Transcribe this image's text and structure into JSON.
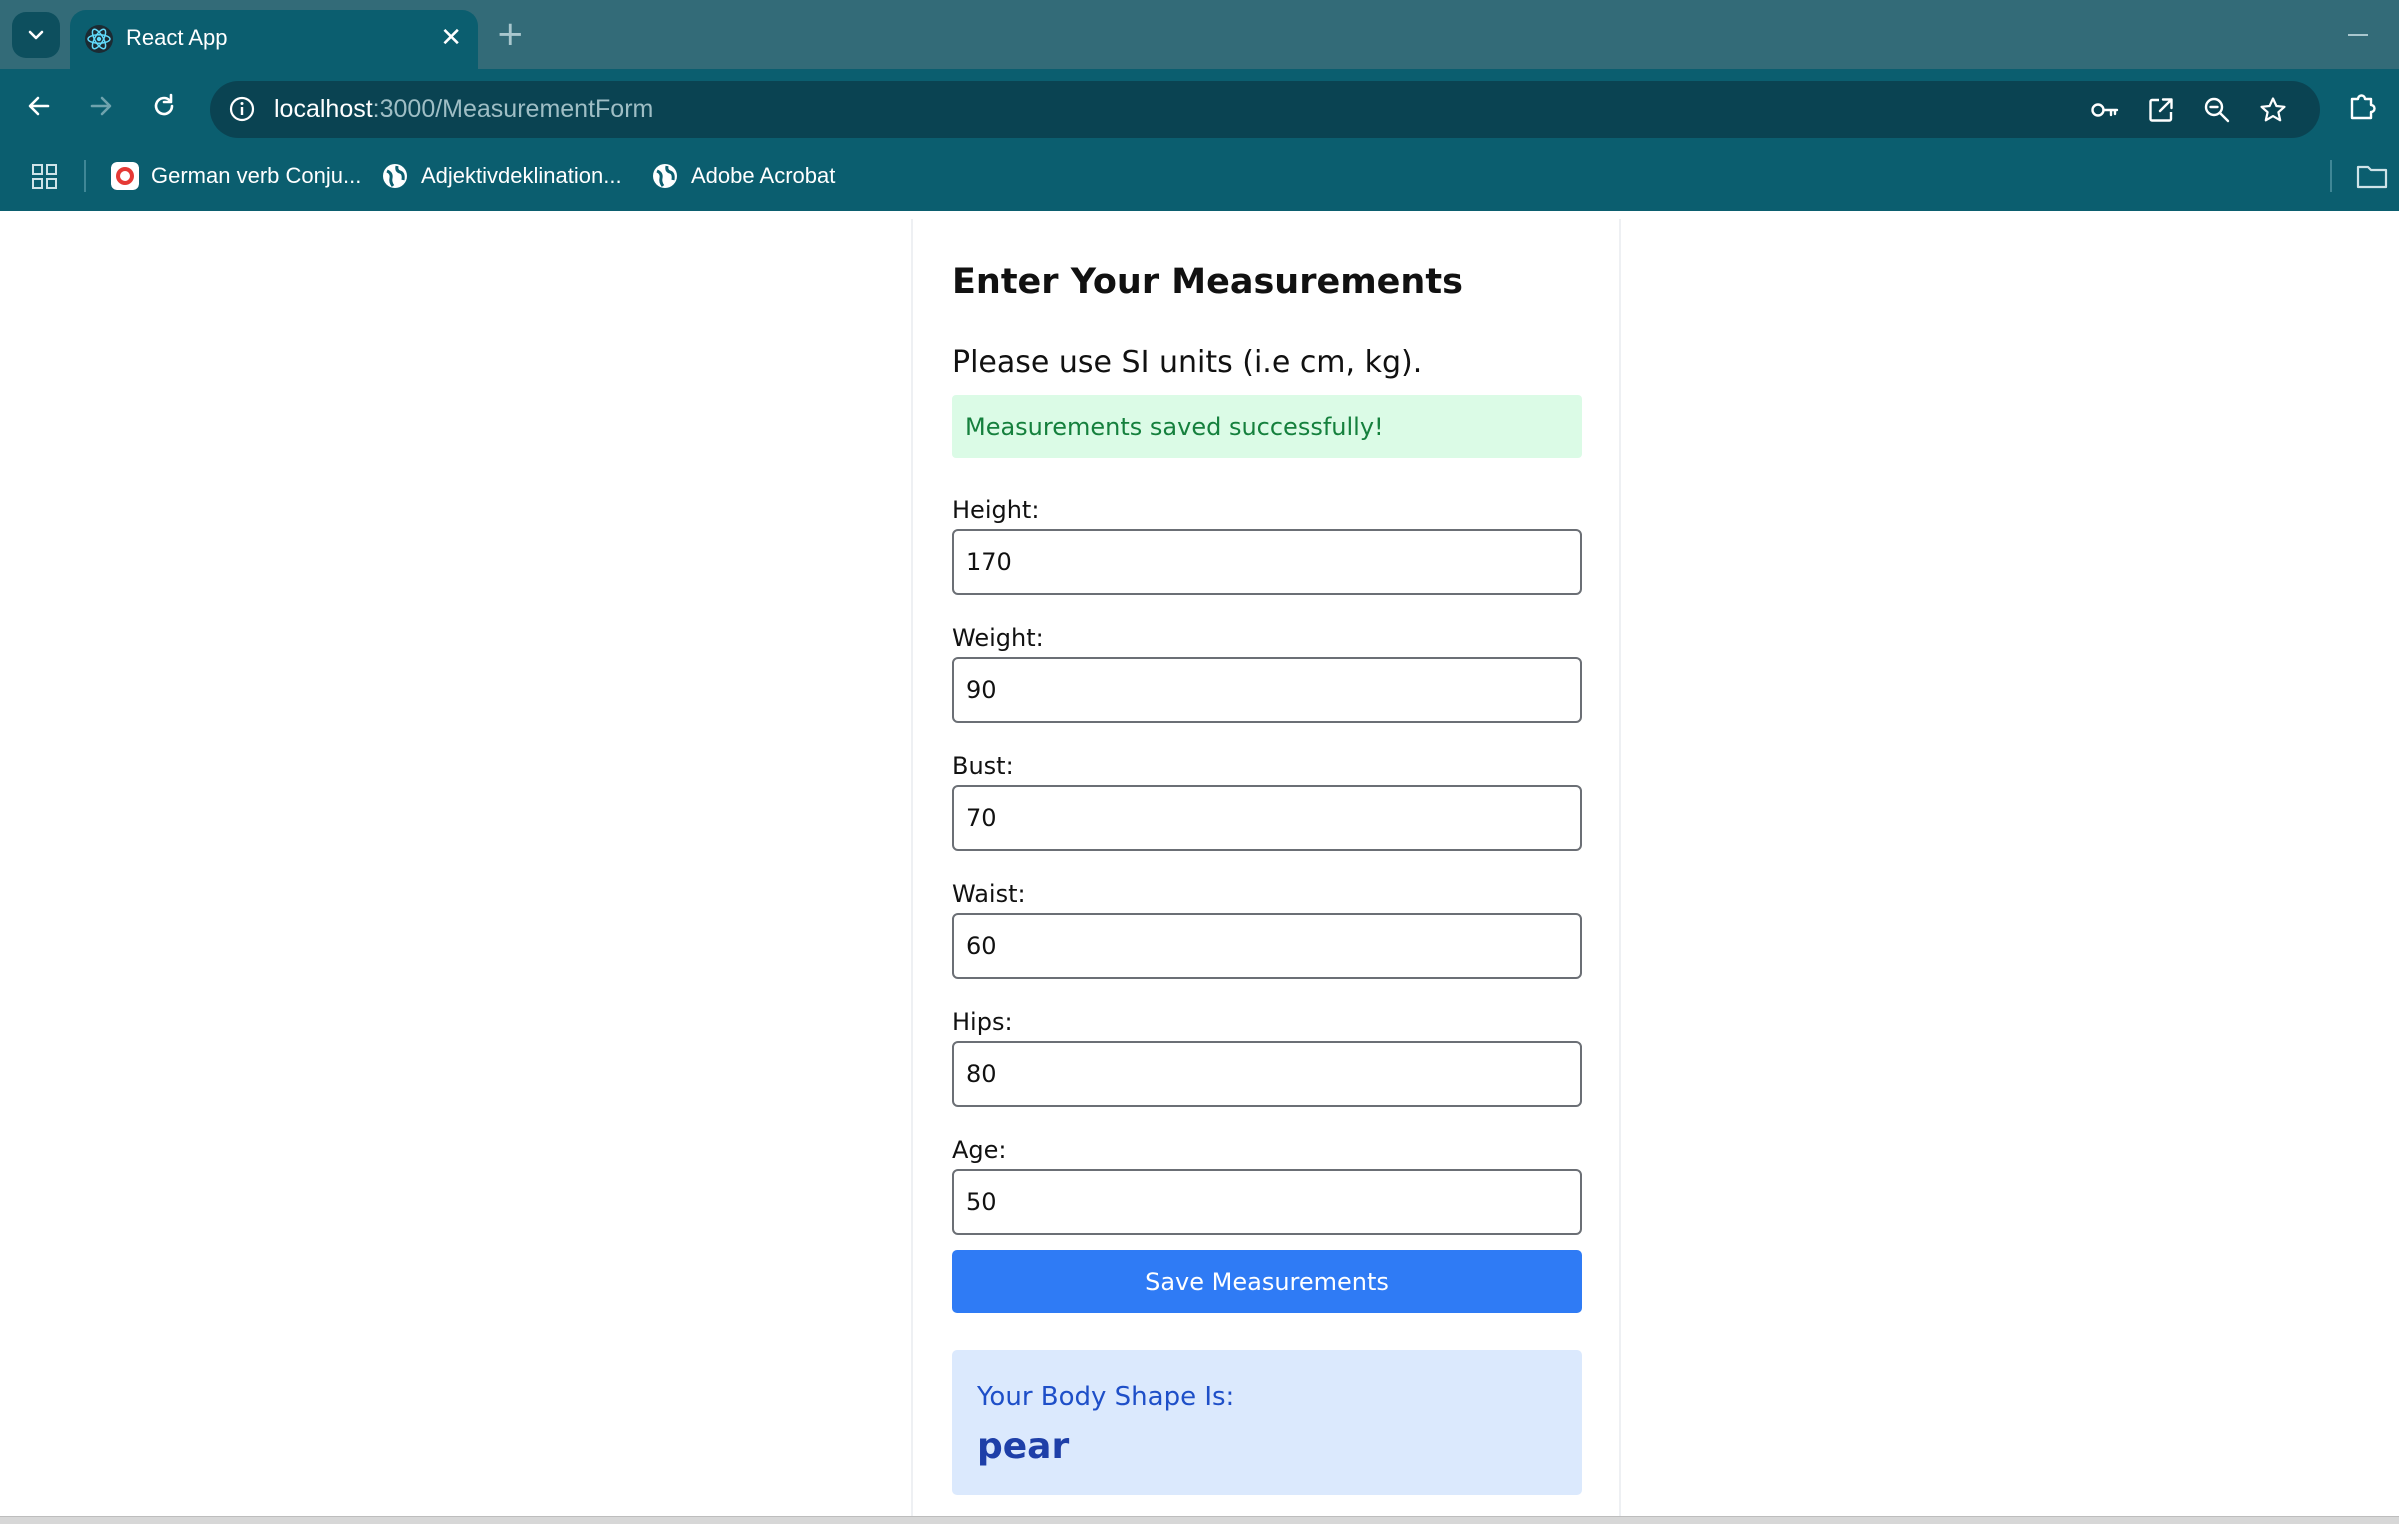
{
  "browser": {
    "tab": {
      "title": "React App",
      "favicon": "react-atom-icon"
    },
    "address": {
      "host": "localhost",
      "rest": ":3000/MeasurementForm"
    },
    "bookmarks": [
      {
        "label": "German verb Conju...",
        "icon": "verb-conjugation-favicon"
      },
      {
        "label": "Adjektivdeklination...",
        "icon": "globe-icon"
      },
      {
        "label": "Adobe Acrobat",
        "icon": "globe-icon"
      }
    ]
  },
  "form": {
    "title": "Enter Your Measurements",
    "subtitle": "Please use SI units (i.e cm, kg).",
    "success_message": "Measurements saved successfully!",
    "fields": [
      {
        "label": "Height:",
        "value": "170"
      },
      {
        "label": "Weight:",
        "value": "90"
      },
      {
        "label": "Bust:",
        "value": "70"
      },
      {
        "label": "Waist:",
        "value": "60"
      },
      {
        "label": "Hips:",
        "value": "80"
      },
      {
        "label": "Age:",
        "value": "50"
      }
    ],
    "save_label": "Save Measurements"
  },
  "result": {
    "label": "Your Body Shape Is:",
    "value": "pear"
  },
  "colors": {
    "primary_button": "#2f7bf5",
    "success_bg": "#dbfbe6",
    "success_text": "#15803d",
    "result_bg": "#dbe9fd",
    "result_text": "#1e4fc8",
    "chrome_teal": "#0b5e6f"
  }
}
